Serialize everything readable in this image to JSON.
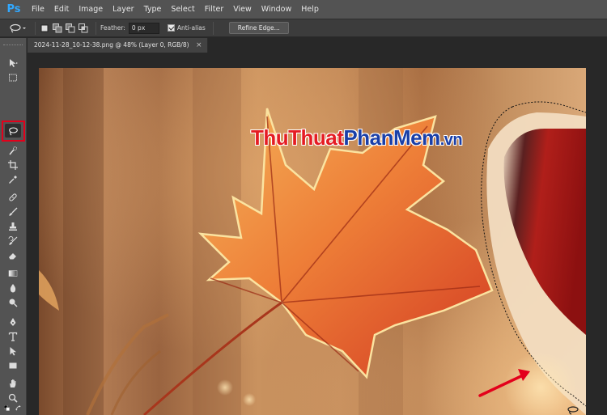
{
  "app": {
    "logo": "Ps",
    "menu": [
      "File",
      "Edit",
      "Image",
      "Layer",
      "Type",
      "Select",
      "Filter",
      "View",
      "Window",
      "Help"
    ]
  },
  "options": {
    "feather_label": "Feather:",
    "feather_value": "0 px",
    "antialias_label": "Anti-alias",
    "antialias_checked": true,
    "refine_label": "Refine Edge..."
  },
  "document": {
    "tab_title": "2024-11-28_10-12-38.png @ 48% (Layer 0, RGB/8)",
    "close_symbol": "×"
  },
  "watermark": {
    "part_a": "ThuThuat",
    "part_b": "PhanMem",
    "part_c": ".vn"
  },
  "toolbar": {
    "active_tool": "lasso-tool",
    "tools": [
      "move-tool",
      "marquee-tool",
      "lasso-tool",
      "quick-selection-tool",
      "crop-tool",
      "eyedropper-tool",
      "healing-brush-tool",
      "brush-tool",
      "clone-stamp-tool",
      "history-brush-tool",
      "eraser-tool",
      "gradient-tool",
      "blur-tool",
      "dodge-tool",
      "pen-tool",
      "type-tool",
      "path-selection-tool",
      "rectangle-tool",
      "hand-tool",
      "zoom-tool"
    ],
    "foreground_color": "#000000",
    "background_color": "#ffffff"
  },
  "colors": {
    "highlight": "#e3001b",
    "arrow": "#e3001b",
    "ps_blue": "#31a8ff"
  }
}
